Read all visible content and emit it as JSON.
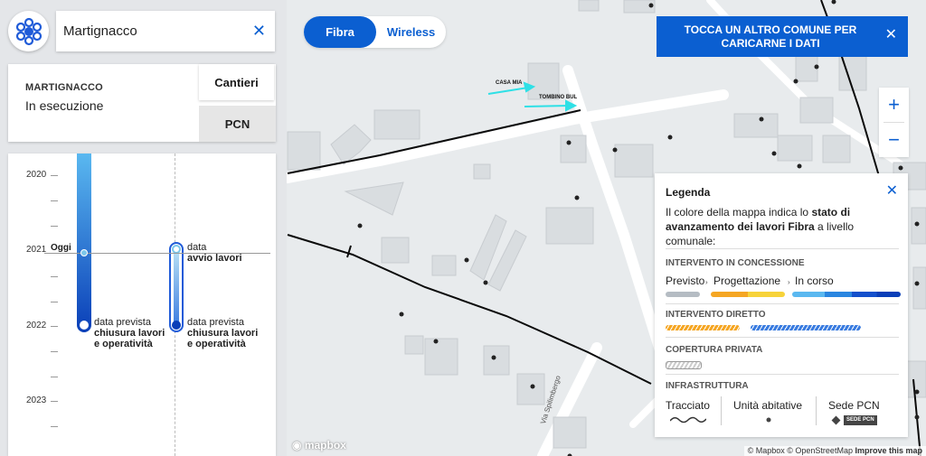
{
  "search": {
    "value": "Martignacco",
    "clear_icon": "close-icon"
  },
  "info": {
    "comune": "MARTIGNACCO",
    "status": "In esecuzione",
    "tabs": {
      "cantieri": "Cantieri",
      "pcn": "PCN"
    }
  },
  "timeline": {
    "years": [
      "2020",
      "2021",
      "2022",
      "2023"
    ],
    "today_label": "Oggi",
    "col_a": {
      "line1": "data prevista",
      "line2": "chiusura lavori",
      "line3": "e operatività"
    },
    "col_b_start": {
      "line1": "data",
      "line2": "avvio lavori"
    },
    "col_b_end": {
      "line1": "data prevista",
      "line2": "chiusura lavori",
      "line3": "e operatività"
    }
  },
  "toggle": {
    "fibra": "Fibra",
    "wireless": "Wireless",
    "selected": "Fibra"
  },
  "notice": {
    "line1": "TOCCA UN ALTRO COMUNE PER",
    "line2": "CARICARNE I DATI"
  },
  "zoom": {
    "in": "+",
    "out": "−"
  },
  "legend": {
    "title": "Legenda",
    "desc_pre": "Il colore della mappa indica lo ",
    "desc_bold": "stato di avanzamento dei lavori Fibra",
    "desc_post": " a livello comunale:",
    "concessione": {
      "title": "INTERVENTO IN CONCESSIONE",
      "steps": [
        "Previsto",
        "Progettazione",
        "In corso"
      ]
    },
    "diretto": {
      "title": "INTERVENTO DIRETTO"
    },
    "privata": {
      "title": "COPERTURA PRIVATA"
    },
    "infrastruttura": {
      "title": "INFRASTRUTTURA",
      "items": [
        "Tracciato",
        "Unità abitative",
        "Sede PCN"
      ],
      "badge": "SEDE PCN"
    },
    "colors": {
      "previsto": "#b5bcc3",
      "progettazione": "#f5a623",
      "in_corso": "#0a3fb8",
      "accent": "#0b5fd1"
    }
  },
  "map": {
    "labels": {
      "casa": "CASA MIA",
      "tombino": "TOMBINO BUL",
      "street": "Via Spilimbergo"
    },
    "mapbox": "mapbox",
    "attribution": {
      "mapbox": "© Mapbox",
      "osm": "© OpenStreetMap",
      "improve": "Improve this map"
    }
  }
}
